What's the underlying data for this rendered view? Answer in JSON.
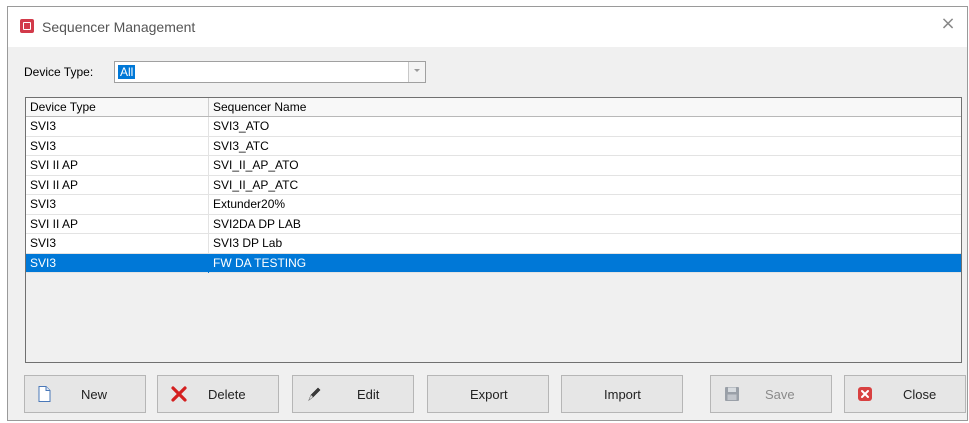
{
  "window": {
    "title": "Sequencer Management",
    "close_glyph": "×"
  },
  "filter": {
    "label": "Device Type:",
    "selected": "All"
  },
  "table": {
    "columns": [
      "Device Type",
      "Sequencer Name"
    ],
    "rows": [
      {
        "device_type": "SVI3",
        "sequencer_name": "SVI3_ATO",
        "selected": false
      },
      {
        "device_type": "SVI3",
        "sequencer_name": "SVI3_ATC",
        "selected": false
      },
      {
        "device_type": "SVI II AP",
        "sequencer_name": "SVI_II_AP_ATO",
        "selected": false
      },
      {
        "device_type": "SVI II AP",
        "sequencer_name": "SVI_II_AP_ATC",
        "selected": false
      },
      {
        "device_type": "SVI3",
        "sequencer_name": "Extunder20%",
        "selected": false
      },
      {
        "device_type": "SVI II AP",
        "sequencer_name": "SVI2DA DP LAB",
        "selected": false
      },
      {
        "device_type": "SVI3",
        "sequencer_name": "SVI3 DP Lab",
        "selected": false
      },
      {
        "device_type": "SVI3",
        "sequencer_name": "FW DA TESTING",
        "selected": true
      }
    ]
  },
  "buttons": {
    "new": {
      "label": "New",
      "icon": "new-document-icon"
    },
    "delete": {
      "label": "Delete",
      "icon": "red-x-icon"
    },
    "edit": {
      "label": "Edit",
      "icon": "pencil-icon"
    },
    "export": {
      "label": "Export"
    },
    "import": {
      "label": "Import"
    },
    "save": {
      "label": "Save",
      "icon": "floppy-disk-icon",
      "disabled": true
    },
    "close": {
      "label": "Close",
      "icon": "close-box-icon"
    }
  },
  "colors": {
    "selection": "#0078d7",
    "app_icon": "#d23a4a",
    "delete_icon": "#d42020",
    "close_icon": "#d84040"
  }
}
